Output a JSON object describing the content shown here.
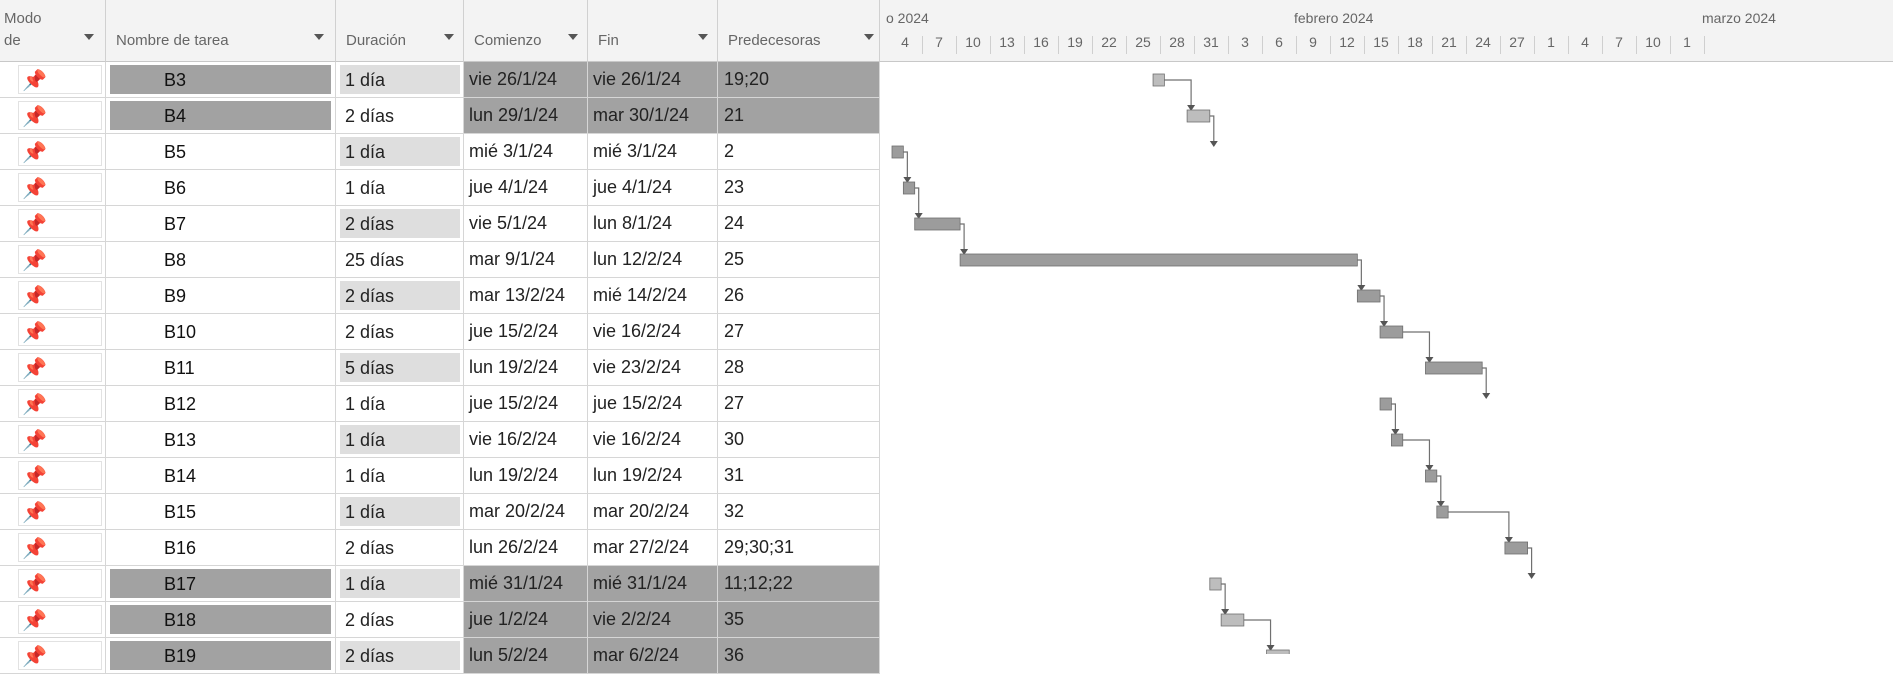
{
  "colors": {
    "header_bg": "#f3f3f3",
    "summary_row_bg": "#a2a2a2",
    "bar_fill": "#9c9c9c",
    "bar_light": "#bdbdbd",
    "link_line": "#707070"
  },
  "columns": {
    "mode_line1": "Modo",
    "mode_line2": "de",
    "name": "Nombre de tarea",
    "duration": "Duración",
    "start": "Comienzo",
    "finish": "Fin",
    "predecessors": "Predecesoras"
  },
  "pin_icon": "📌",
  "tasks": [
    {
      "name": "B3",
      "duration": "1 día",
      "start": "vie 26/1/24",
      "finish": "vie 26/1/24",
      "pred": "19;20",
      "summary": true
    },
    {
      "name": "B4",
      "duration": "2 días",
      "start": "lun 29/1/24",
      "finish": "mar 30/1/24",
      "pred": "21",
      "summary": true
    },
    {
      "name": "B5",
      "duration": "1 día",
      "start": "mié 3/1/24",
      "finish": "mié 3/1/24",
      "pred": "2",
      "summary": false
    },
    {
      "name": "B6",
      "duration": "1 día",
      "start": "jue 4/1/24",
      "finish": "jue 4/1/24",
      "pred": "23",
      "summary": false
    },
    {
      "name": "B7",
      "duration": "2 días",
      "start": "vie 5/1/24",
      "finish": "lun 8/1/24",
      "pred": "24",
      "summary": false
    },
    {
      "name": "B8",
      "duration": "25 días",
      "start": "mar 9/1/24",
      "finish": "lun 12/2/24",
      "pred": "25",
      "summary": false
    },
    {
      "name": "B9",
      "duration": "2 días",
      "start": "mar 13/2/24",
      "finish": "mié 14/2/24",
      "pred": "26",
      "summary": false
    },
    {
      "name": "B10",
      "duration": "2 días",
      "start": "jue 15/2/24",
      "finish": "vie 16/2/24",
      "pred": "27",
      "summary": false
    },
    {
      "name": "B11",
      "duration": "5 días",
      "start": "lun 19/2/24",
      "finish": "vie 23/2/24",
      "pred": "28",
      "summary": false
    },
    {
      "name": "B12",
      "duration": "1 día",
      "start": "jue 15/2/24",
      "finish": "jue 15/2/24",
      "pred": "27",
      "summary": false
    },
    {
      "name": "B13",
      "duration": "1 día",
      "start": "vie 16/2/24",
      "finish": "vie 16/2/24",
      "pred": "30",
      "summary": false
    },
    {
      "name": "B14",
      "duration": "1 día",
      "start": "lun 19/2/24",
      "finish": "lun 19/2/24",
      "pred": "31",
      "summary": false
    },
    {
      "name": "B15",
      "duration": "1 día",
      "start": "mar 20/2/24",
      "finish": "mar 20/2/24",
      "pred": "32",
      "summary": false
    },
    {
      "name": "B16",
      "duration": "2 días",
      "start": "lun 26/2/24",
      "finish": "mar 27/2/24",
      "pred": "29;30;31",
      "summary": false
    },
    {
      "name": "B17",
      "duration": "1 día",
      "start": "mié 31/1/24",
      "finish": "mié 31/1/24",
      "pred": "11;12;22",
      "summary": true
    },
    {
      "name": "B18",
      "duration": "2 días",
      "start": "jue 1/2/24",
      "finish": "vie 2/2/24",
      "pred": "35",
      "summary": true
    },
    {
      "name": "B19",
      "duration": "2 días",
      "start": "lun 5/2/24",
      "finish": "mar 6/2/24",
      "pred": "36",
      "summary": true
    }
  ],
  "timeline": {
    "months": [
      "o 2024",
      "febrero 2024",
      "marzo 2024"
    ],
    "days": [
      "4",
      "7",
      "10",
      "13",
      "16",
      "19",
      "22",
      "25",
      "28",
      "31",
      "3",
      "6",
      "9",
      "12",
      "15",
      "18",
      "21",
      "24",
      "27",
      "1",
      "4",
      "7",
      "10",
      "1"
    ]
  }
}
